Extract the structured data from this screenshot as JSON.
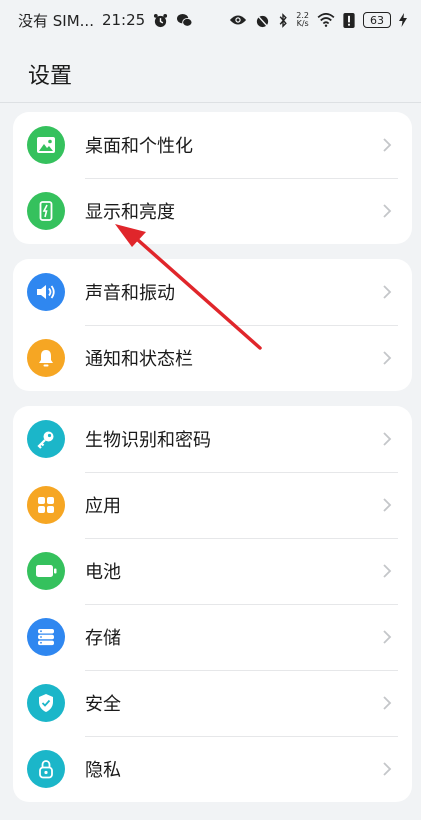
{
  "status_bar": {
    "carrier": "没有 SIM...",
    "time": "21:25",
    "net_speed_top": "2.2",
    "net_speed_bottom": "K/s",
    "battery": "63"
  },
  "header": {
    "title": "设置"
  },
  "groups": [
    {
      "items": [
        {
          "label": "桌面和个性化",
          "icon": "image-icon",
          "color": "#35c15d"
        },
        {
          "label": "显示和亮度",
          "icon": "phone-brightness-icon",
          "color": "#35c15d"
        }
      ]
    },
    {
      "items": [
        {
          "label": "声音和振动",
          "icon": "speaker-icon",
          "color": "#2f87f0"
        },
        {
          "label": "通知和状态栏",
          "icon": "bell-icon",
          "color": "#f6a623"
        }
      ]
    },
    {
      "items": [
        {
          "label": "生物识别和密码",
          "icon": "key-icon",
          "color": "#1bb6c9"
        },
        {
          "label": "应用",
          "icon": "apps-grid-icon",
          "color": "#f6a623"
        },
        {
          "label": "电池",
          "icon": "battery-icon",
          "color": "#35c15d"
        },
        {
          "label": "存储",
          "icon": "storage-icon",
          "color": "#2f87f0"
        },
        {
          "label": "安全",
          "icon": "shield-check-icon",
          "color": "#1bb6c9"
        },
        {
          "label": "隐私",
          "icon": "privacy-lock-icon",
          "color": "#1bb6c9"
        }
      ]
    }
  ],
  "annotation": {
    "arrow_color": "#e0262b"
  }
}
